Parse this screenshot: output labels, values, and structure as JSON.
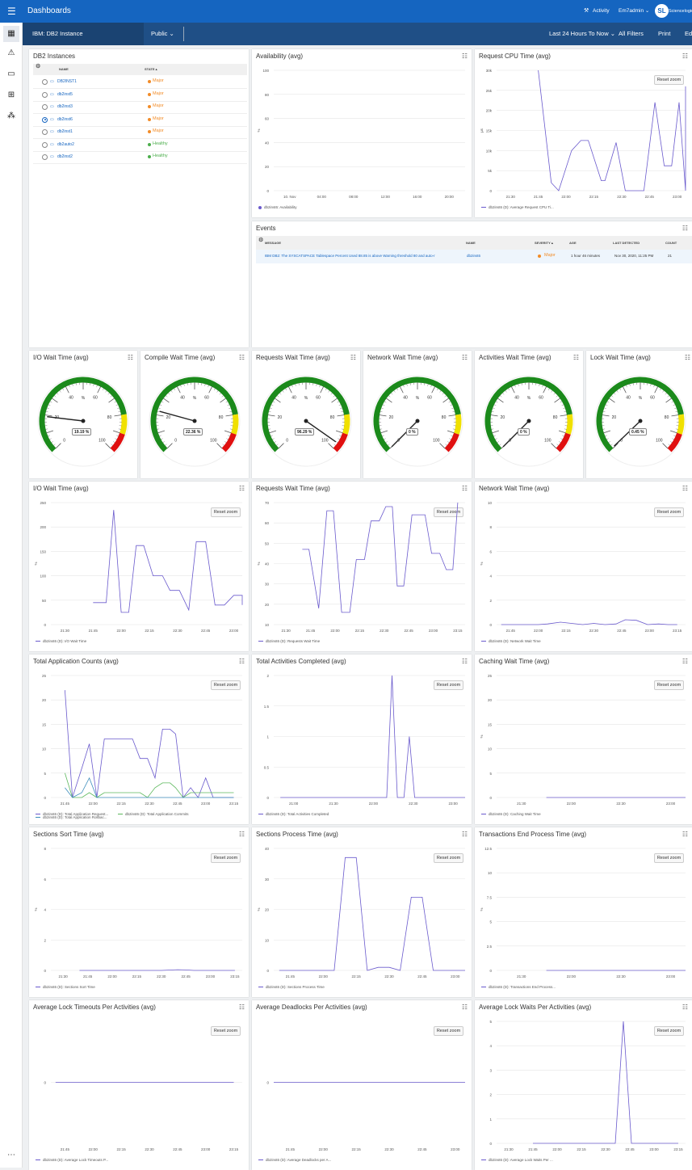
{
  "topbar": {
    "app_title": "Dashboards",
    "activity": "Activity",
    "user": "Em7admin",
    "brand": "Sciencelogic"
  },
  "subbar": {
    "dashboard_name": "IBM: DB2 Instance",
    "visibility": "Public",
    "time_range": "Last 24 Hours To Now",
    "all_filters": "All Filters",
    "print": "Print",
    "edit": "Edit"
  },
  "colors": {
    "primary": "#1565c0",
    "series_purple": "#6a5acd",
    "series_blue": "#3c8dbc",
    "series_green": "#5cb85c",
    "major": "#f28c28",
    "healthy": "#4cae4c",
    "gauge_green": "#1b8a1b",
    "gauge_yellow": "#f0e000",
    "gauge_red": "#e01010"
  },
  "sidebar_icons": [
    "dashboard-icon",
    "alert-icon",
    "devices-icon",
    "toolbox-icon",
    "topology-icon"
  ],
  "instances": {
    "title": "DB2 Instances",
    "col_name": "NAME",
    "col_state": "STATE",
    "rows": [
      {
        "name": "DB2INST1",
        "state": "Major",
        "selected": false
      },
      {
        "name": "db2inst5",
        "state": "Major",
        "selected": false
      },
      {
        "name": "db2inst3",
        "state": "Major",
        "selected": false
      },
      {
        "name": "db2inst6",
        "state": "Major",
        "selected": true
      },
      {
        "name": "db2inst1",
        "state": "Major",
        "selected": false
      },
      {
        "name": "db2auto2",
        "state": "Healthy",
        "selected": false
      },
      {
        "name": "db2inst2",
        "state": "Healthy",
        "selected": false
      }
    ]
  },
  "events": {
    "title": "Events",
    "col_message": "MESSAGE",
    "col_name": "NAME",
    "col_severity": "SEVERITY",
    "col_age": "AGE",
    "col_last": "LAST DETECTED",
    "col_count": "COUNT",
    "rows": [
      {
        "message": "IBM DB2: The SYSCATSPACE Tablespace Percent Used 88.85 is above Warning threshold 80 and auto-r",
        "name": "db2inst6",
        "severity": "Major",
        "age": "1 hour 46 minutes",
        "last_detected": "Nov 30, 2020, 11:25 PM",
        "count": "21"
      }
    ]
  },
  "gauges": [
    {
      "title": "I/O Wait Time (avg)",
      "value": 19.19,
      "label": "19.19 %"
    },
    {
      "title": "Compile Wait Time (avg)",
      "value": 22.36,
      "label": "22.36 %"
    },
    {
      "title": "Requests Wait Time (avg)",
      "value": 96.29,
      "label": "96.29 %"
    },
    {
      "title": "Network Wait Time (avg)",
      "value": 0,
      "label": "0 %"
    },
    {
      "title": "Activities Wait Time (avg)",
      "value": 0,
      "label": "0 %"
    },
    {
      "title": "Lock Wait Time (avg)",
      "value": 0.45,
      "label": "0.45 %"
    }
  ],
  "gauge_ticks": [
    "0",
    "20",
    "40",
    "60",
    "80",
    "100"
  ],
  "gauge_unit": "%",
  "reset_zoom": "Reset zoom",
  "chart_data": [
    {
      "title": "Availability (avg)",
      "type": "line",
      "ylabel": "%",
      "ylim": [
        0,
        100
      ],
      "yticks": [
        "100",
        "80",
        "60",
        "40",
        "20",
        "0"
      ],
      "xticks": [
        "10. Nov",
        "04:00",
        "08:00",
        "12:00",
        "16:00",
        "20:00"
      ],
      "series": [
        {
          "name": "db2inst6: Availability",
          "x": [],
          "values": []
        }
      ],
      "reset": false
    },
    {
      "title": "Request CPU Time (avg)",
      "type": "line",
      "ylabel": "μs",
      "ylim": [
        0,
        30000
      ],
      "yticks": [
        "30k",
        "25k",
        "20k",
        "15k",
        "10k",
        "5k",
        "0"
      ],
      "xticks": [
        "21:30",
        "21:45",
        "22:00",
        "22:15",
        "22:30",
        "22:45",
        "23:00"
      ],
      "series": [
        {
          "name": "db2inst6 (D): Average Request CPU Ti...",
          "x": [
            "21:45",
            "21:52",
            "21:56",
            "22:03",
            "22:08",
            "22:12",
            "22:19",
            "22:21",
            "22:27",
            "22:32",
            "22:38",
            "22:42",
            "22:48",
            "22:53",
            "22:57",
            "23:01",
            "23:06",
            "23:12",
            "23:16"
          ],
          "values": [
            30000,
            2000,
            0,
            10000,
            12500,
            12500,
            2500,
            2500,
            12000,
            0,
            0,
            0,
            22000,
            6200,
            6200,
            22000,
            0,
            26000,
            13500
          ]
        }
      ],
      "reset": true
    },
    {
      "title": "I/O Wait Time (avg)",
      "type": "line",
      "ylabel": "%",
      "ylim": [
        0,
        250
      ],
      "yticks": [
        "250",
        "200",
        "150",
        "100",
        "50",
        "0"
      ],
      "xticks": [
        "21:30",
        "21:45",
        "22:00",
        "22:15",
        "22:30",
        "22:45",
        "23:00"
      ],
      "series": [
        {
          "name": "db2inst6 (D): I/O Wait Time",
          "x": [
            "21:45",
            "21:52",
            "21:56",
            "22:00",
            "22:04",
            "22:08",
            "22:12",
            "22:17",
            "22:22",
            "22:26",
            "22:31",
            "22:36",
            "22:40",
            "22:45",
            "22:50",
            "22:55",
            "23:00",
            "23:06",
            "23:10",
            "23:15"
          ],
          "values": [
            45,
            45,
            235,
            25,
            25,
            162,
            162,
            100,
            100,
            70,
            70,
            30,
            170,
            170,
            40,
            40,
            60,
            60,
            40,
            40
          ]
        }
      ],
      "reset": true
    },
    {
      "title": "Requests Wait Time (avg)",
      "type": "line",
      "ylabel": "%",
      "ylim": [
        10,
        70
      ],
      "yticks": [
        "70",
        "60",
        "50",
        "40",
        "30",
        "20",
        "10"
      ],
      "xticks": [
        "21:30",
        "21:45",
        "22:00",
        "22:15",
        "22:30",
        "22:45",
        "23:00",
        "23:15"
      ],
      "series": [
        {
          "name": "db2inst6 (D): Requests Wait Time",
          "x": [
            "21:40",
            "21:44",
            "21:50",
            "21:55",
            "21:59",
            "22:04",
            "22:09",
            "22:13",
            "22:18",
            "22:22",
            "22:27",
            "22:31",
            "22:35",
            "22:38",
            "22:42",
            "22:47",
            "22:51",
            "22:55",
            "22:59",
            "23:04",
            "23:08",
            "23:12",
            "23:15"
          ],
          "values": [
            47,
            47,
            18,
            66,
            66,
            16,
            16,
            42,
            42,
            61,
            61,
            68,
            68,
            29,
            29,
            64,
            64,
            64,
            45,
            45,
            37,
            37,
            70
          ]
        }
      ],
      "reset": true
    },
    {
      "title": "Network Wait Time (avg)",
      "type": "line",
      "ylabel": "%",
      "ylim": [
        0,
        10
      ],
      "yticks": [
        "10",
        "8",
        "6",
        "4",
        "2",
        "0"
      ],
      "xticks": [
        "21:45",
        "22:00",
        "22:15",
        "22:30",
        "22:45",
        "23:00",
        "23:15"
      ],
      "series": [
        {
          "name": "db2inst6 (D): Network Wait Time",
          "x": [
            "21:40",
            "21:50",
            "22:00",
            "22:05",
            "22:12",
            "22:18",
            "22:24",
            "22:30",
            "22:36",
            "22:42",
            "22:47",
            "22:53",
            "22:59",
            "23:05",
            "23:10",
            "23:15"
          ],
          "values": [
            0,
            0,
            0,
            0.05,
            0.2,
            0.1,
            0,
            0.1,
            0,
            0.05,
            0.4,
            0.35,
            0,
            0.05,
            0,
            0
          ]
        }
      ],
      "reset": true
    },
    {
      "title": "Total Application Counts (avg)",
      "type": "line",
      "ylabel": "",
      "ylim": [
        0,
        25
      ],
      "yticks": [
        "25",
        "20",
        "15",
        "10",
        "5",
        "0"
      ],
      "xticks": [
        "21:45",
        "22:00",
        "22:15",
        "22:30",
        "22:45",
        "23:00",
        "23:15"
      ],
      "series": [
        {
          "name": "db2inst6 (D): Total Application Request...",
          "x": [
            "21:45",
            "21:49",
            "21:54",
            "21:58",
            "22:02",
            "22:06",
            "22:12",
            "22:16",
            "22:21",
            "22:25",
            "22:29",
            "22:33",
            "22:37",
            "22:41",
            "22:44",
            "22:48",
            "22:52",
            "22:56",
            "23:00",
            "23:04",
            "23:08",
            "23:12",
            "23:15"
          ],
          "values": [
            22,
            0,
            6,
            11,
            0,
            12,
            12,
            12,
            12,
            8,
            8,
            4,
            14,
            14,
            13,
            0,
            2,
            0,
            4,
            0,
            0,
            0,
            0
          ]
        },
        {
          "name": "db2inst6 (D): Total Application Commits",
          "x": [
            "21:45",
            "21:49",
            "21:54",
            "21:58",
            "22:02",
            "22:06",
            "22:12",
            "22:16",
            "22:21",
            "22:25",
            "22:29",
            "22:33",
            "22:37",
            "22:41",
            "22:44",
            "22:48",
            "22:52",
            "22:56",
            "23:00",
            "23:04",
            "23:08",
            "23:12",
            "23:15"
          ],
          "values": [
            5,
            0,
            0,
            1,
            0,
            1,
            1,
            1,
            1,
            1,
            0,
            2,
            3,
            3,
            2,
            0,
            1,
            1,
            1,
            1,
            1,
            1,
            1
          ]
        },
        {
          "name": "db2inst6 (D): Total Application Rollbac...",
          "x": [
            "21:45",
            "21:49",
            "21:54",
            "21:58",
            "22:02",
            "22:06",
            "22:12",
            "22:16",
            "22:21",
            "22:25",
            "22:29",
            "22:33",
            "22:37",
            "22:41",
            "22:44",
            "22:48",
            "22:52",
            "22:56",
            "23:00",
            "23:04",
            "23:08",
            "23:12",
            "23:15"
          ],
          "values": [
            2,
            0,
            1,
            4,
            0,
            0,
            0,
            0,
            0,
            0,
            0,
            0,
            0,
            0,
            0,
            0,
            0,
            0,
            0,
            0,
            0,
            0,
            0
          ]
        }
      ],
      "reset": true
    },
    {
      "title": "Total Activities Completed (avg)",
      "type": "line",
      "ylabel": "",
      "ylim": [
        0,
        2
      ],
      "yticks": [
        "2",
        "1.5",
        "1",
        "0.5",
        "0"
      ],
      "xticks": [
        "21:00",
        "21:30",
        "22:00",
        "22:30",
        "23:00"
      ],
      "series": [
        {
          "name": "db2inst6 (D): Total Activities Completed",
          "x": [
            "20:50",
            "22:05",
            "22:10",
            "22:14",
            "22:18",
            "22:23",
            "22:27",
            "22:31",
            "22:35",
            "23:15"
          ],
          "values": [
            0,
            0,
            0,
            2,
            0,
            0,
            1,
            0,
            0,
            0
          ]
        }
      ],
      "reset": true
    },
    {
      "title": "Caching Wait Time (avg)",
      "type": "line",
      "ylabel": "%",
      "ylim": [
        0,
        25
      ],
      "yticks": [
        "25",
        "20",
        "15",
        "10",
        "5",
        "0"
      ],
      "xticks": [
        "21:30",
        "22:00",
        "22:30",
        "23:00"
      ],
      "series": [
        {
          "name": "db2inst6 (D): Caching Wait Time",
          "x": [
            "21:45",
            "23:15"
          ],
          "values": [
            0,
            0
          ]
        }
      ],
      "reset": true
    },
    {
      "title": "Sections Sort Time (avg)",
      "type": "line",
      "ylabel": "%",
      "ylim": [
        0,
        8
      ],
      "yticks": [
        "8",
        "6",
        "4",
        "2",
        "0"
      ],
      "xticks": [
        "21:30",
        "21:45",
        "22:00",
        "22:15",
        "22:30",
        "22:45",
        "23:00",
        "23:15"
      ],
      "series": [
        {
          "name": "db2inst6 (D): Sections Sort Time",
          "x": [
            "21:40",
            "22:30",
            "22:40",
            "22:45",
            "22:50",
            "23:15"
          ],
          "values": [
            0,
            0,
            0.05,
            0.03,
            0,
            0
          ]
        }
      ],
      "reset": true
    },
    {
      "title": "Sections Process Time (avg)",
      "type": "line",
      "ylabel": "%",
      "ylim": [
        0,
        40
      ],
      "yticks": [
        "40",
        "30",
        "20",
        "10",
        "0"
      ],
      "xticks": [
        "21:45",
        "22:00",
        "22:15",
        "22:30",
        "22:45",
        "23:00"
      ],
      "series": [
        {
          "name": "db2inst6 (D): Sections Process Time",
          "x": [
            "21:40",
            "22:05",
            "22:10",
            "22:15",
            "22:20",
            "22:25",
            "22:30",
            "22:35",
            "22:40",
            "22:45",
            "22:50",
            "23:15"
          ],
          "values": [
            0,
            0,
            37,
            37,
            0,
            1,
            1,
            0,
            24,
            24,
            0,
            0
          ]
        }
      ],
      "reset": true
    },
    {
      "title": "Transactions End Process Time (avg)",
      "type": "line",
      "ylabel": "%",
      "ylim": [
        0,
        12.5
      ],
      "yticks": [
        "12.5",
        "10",
        "7.5",
        "5",
        "2.5",
        "0"
      ],
      "xticks": [
        "21:30",
        "22:00",
        "22:30",
        "23:00"
      ],
      "series": [
        {
          "name": "db2inst6 (D): Transactions End Process...",
          "x": [
            "21:45",
            "23:15"
          ],
          "values": [
            0,
            0
          ]
        }
      ],
      "reset": true
    },
    {
      "title": "Average Lock Timeouts Per Activities (avg)",
      "type": "line",
      "ylabel": "",
      "ylim": [
        -1,
        1
      ],
      "yticks": [
        "0"
      ],
      "xticks": [
        "21:45",
        "22:00",
        "22:15",
        "22:30",
        "22:45",
        "23:00",
        "23:15"
      ],
      "series": [
        {
          "name": "db2inst6 (D): Average Lock Timeouts P...",
          "x": [
            "21:40",
            "23:15"
          ],
          "values": [
            0,
            0
          ]
        }
      ],
      "reset": true
    },
    {
      "title": "Average Deadlocks Per Activities (avg)",
      "type": "line",
      "ylabel": "",
      "ylim": [
        -1,
        1
      ],
      "yticks": [
        "0"
      ],
      "xticks": [
        "21:45",
        "22:00",
        "22:15",
        "22:30",
        "22:45",
        "23:00"
      ],
      "series": [
        {
          "name": "db2inst6 (D): Average Deadlocks per A...",
          "x": [
            "21:30",
            "23:15"
          ],
          "values": [
            0,
            0
          ]
        }
      ],
      "reset": true
    },
    {
      "title": "Average Lock Waits Per Activities (avg)",
      "type": "line",
      "ylabel": "",
      "ylim": [
        0,
        5
      ],
      "yticks": [
        "5",
        "4",
        "3",
        "2",
        "1",
        "0"
      ],
      "xticks": [
        "21:30",
        "21:45",
        "22:00",
        "22:15",
        "22:30",
        "22:45",
        "23:00",
        "23:15"
      ],
      "series": [
        {
          "name": "db2inst6 (D): Average Lock Waits Per ...",
          "x": [
            "21:45",
            "22:36",
            "22:41",
            "22:46",
            "23:15"
          ],
          "values": [
            0,
            0,
            5,
            0,
            0
          ]
        }
      ],
      "reset": true
    }
  ]
}
